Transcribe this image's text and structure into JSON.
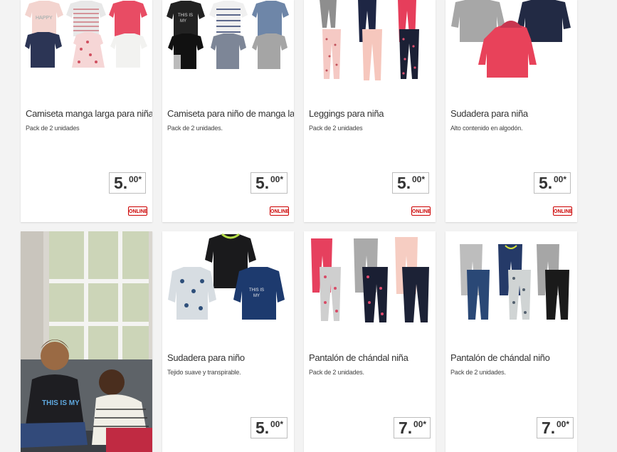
{
  "products": [
    {
      "title": "Camiseta manga larga para niña",
      "subtitle": "Pack de 2 unidades",
      "price_main": "5.",
      "price_cents": "00*",
      "badge": "ONLINE"
    },
    {
      "title": "Camiseta para niño de manga larga",
      "subtitle": "Pack de 2 unidades.",
      "price_main": "5.",
      "price_cents": "00*",
      "badge": "ONLINE"
    },
    {
      "title": "Leggings para niña",
      "subtitle": "Pack de 2 unidades",
      "price_main": "5.",
      "price_cents": "00*",
      "badge": "ONLINE"
    },
    {
      "title": "Sudadera para niña",
      "subtitle": "Alto contenido en algodón.",
      "price_main": "5.",
      "price_cents": "00*",
      "badge": "ONLINE"
    },
    {
      "title": "Sudadera para niño",
      "subtitle": "Tejido suave y transpirable.",
      "price_main": "5.",
      "price_cents": "00*"
    },
    {
      "title": "Pantalón de chándal niña",
      "subtitle": "Pack de 2 unidades.",
      "price_main": "7.",
      "price_cents": "00*"
    },
    {
      "title": "Pantalón de chándal niño",
      "subtitle": "Pack de 2 unidades.",
      "price_main": "7.",
      "price_cents": "00*"
    }
  ],
  "promo": {
    "shirt_text": "THIS IS MY"
  },
  "colors": {
    "badge_red": "#cc0000",
    "page_bg": "#f3f3f3",
    "text": "#333333"
  }
}
